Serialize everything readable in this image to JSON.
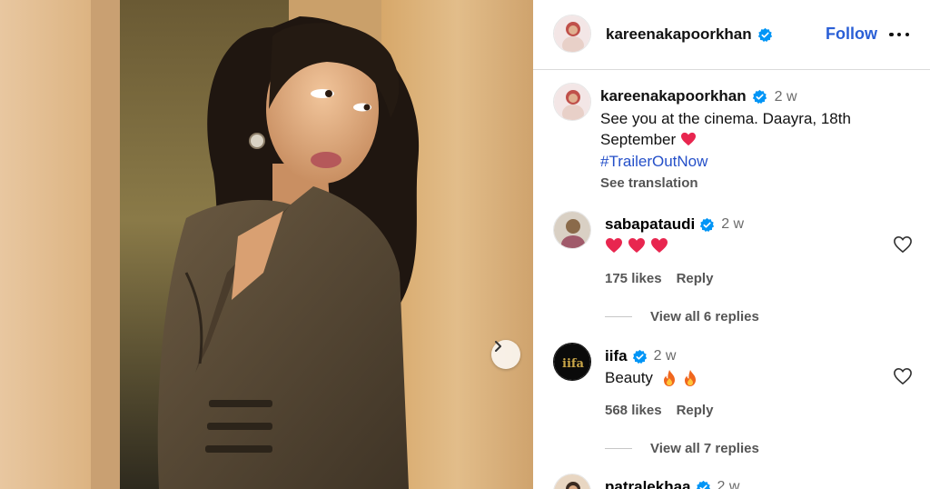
{
  "post": {
    "author": "kareenakapoorkhan",
    "follow_label": "Follow",
    "caption": {
      "username": "kareenakapoorkhan",
      "time": "2 w",
      "text": "See you at the cinema. Daayra, 18th September",
      "hashtag": "#TrailerOutNow",
      "see_translation": "See translation"
    }
  },
  "comments": [
    {
      "username": "sabapataudi",
      "verified": true,
      "time": "2 w",
      "body_text": "",
      "emojis": [
        "heart",
        "heart",
        "heart"
      ],
      "likes": "175 likes",
      "reply_label": "Reply",
      "view_replies": "View all 6 replies"
    },
    {
      "username": "iifa",
      "verified": true,
      "time": "2 w",
      "body_text": "Beauty",
      "emojis": [
        "fire",
        "fire"
      ],
      "likes": "568 likes",
      "reply_label": "Reply",
      "view_replies": "View all 7 replies"
    },
    {
      "username": "patralekhaa",
      "verified": true,
      "time": "2 w"
    }
  ],
  "iifa_logo_text": "iifa",
  "colors": {
    "verified_blue": "#0095f6",
    "follow_blue": "#2a5fd6",
    "hashtag_blue": "#2550c9",
    "heart_red": "#e8264f"
  },
  "icons": {
    "next": "chevron-right-icon",
    "more": "more-horizontal-icon",
    "like": "heart-outline-icon",
    "verified": "verified-badge-icon"
  }
}
